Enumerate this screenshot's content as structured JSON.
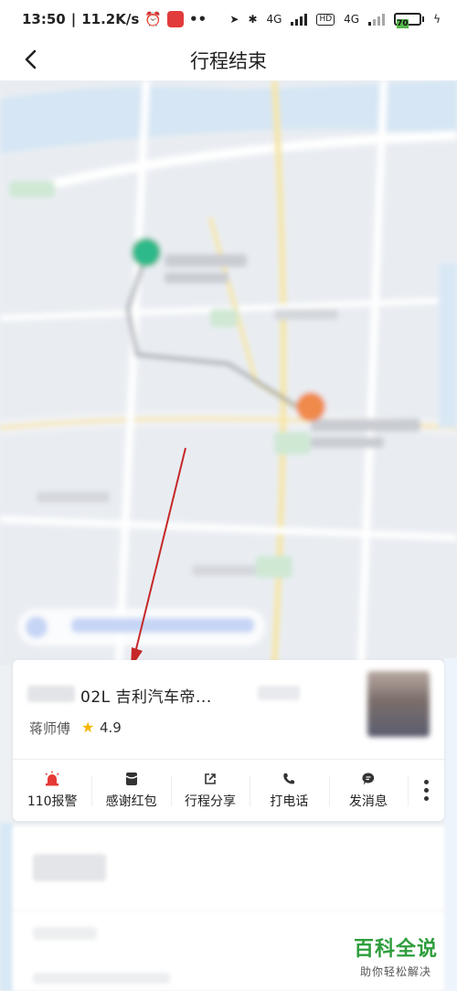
{
  "status_bar": {
    "time": "13:50",
    "net_speed": "11.2K/s",
    "net_type_1": "4G",
    "hd_label": "HD",
    "net_type_2": "4G",
    "battery": "70"
  },
  "nav": {
    "title": "行程结束"
  },
  "driver_card": {
    "car": "02L  吉利汽车帝...",
    "driver_name": "蒋师傅",
    "rating": "4.9",
    "actions": [
      {
        "label": "110报警",
        "icon": "alarm-icon",
        "color": "#e53935"
      },
      {
        "label": "感谢红包",
        "icon": "red-packet-icon",
        "color": "#333333"
      },
      {
        "label": "行程分享",
        "icon": "share-icon",
        "color": "#333333"
      },
      {
        "label": "打电话",
        "icon": "phone-icon",
        "color": "#333333"
      },
      {
        "label": "发消息",
        "icon": "message-icon",
        "color": "#333333"
      }
    ]
  },
  "watermark": {
    "title": "百科全说",
    "subtitle": "助你轻松解决"
  },
  "colors": {
    "rating_star": "#f7b500",
    "alarm": "#e53935",
    "annotation_arrow": "#c62828",
    "start_marker": "#2fb98a",
    "end_marker": "#f08a4b",
    "watermark": "#2e9e3c"
  }
}
